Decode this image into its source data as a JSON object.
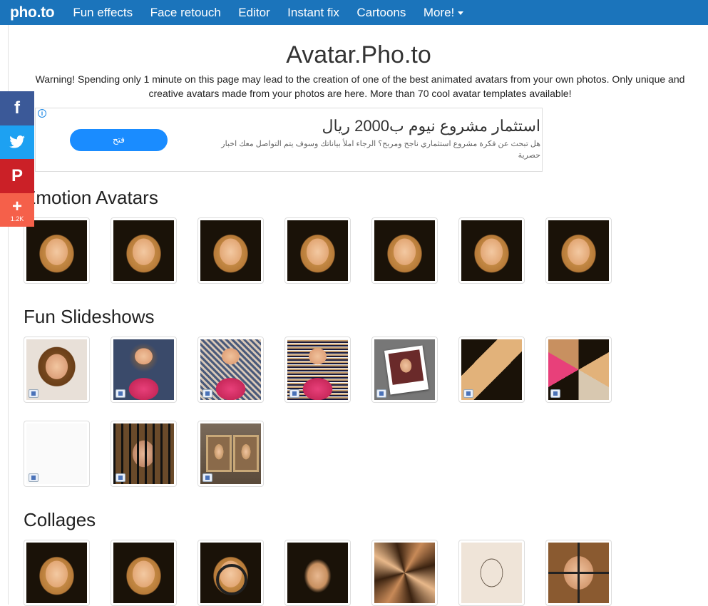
{
  "header": {
    "logo": "pho.to",
    "nav": [
      "Fun effects",
      "Face retouch",
      "Editor",
      "Instant fix",
      "Cartoons",
      "More!"
    ]
  },
  "page": {
    "title": "Avatar.Pho.to",
    "intro": "Warning! Spending only 1 minute on this page may lead to the creation of one of the best animated avatars from your own photos. Only unique and creative avatars made from your photos are here. More than 70 cool avatar templates available!"
  },
  "social": {
    "share_count": "1.2K"
  },
  "ad": {
    "button": "فتح",
    "headline": "استثمار مشروع نيوم ب2000 ريال",
    "body": "هل تبحث عن فكرة مشروع استثماري ناجح ومربح؟ الرجاء املأ بياناتك وسوف يتم التواصل معك اخبار حصرية"
  },
  "sections": {
    "emotion": "Emotion Avatars",
    "slideshows": "Fun Slideshows",
    "collages": "Collages"
  },
  "colors": {
    "brand": "#1b74bb"
  }
}
